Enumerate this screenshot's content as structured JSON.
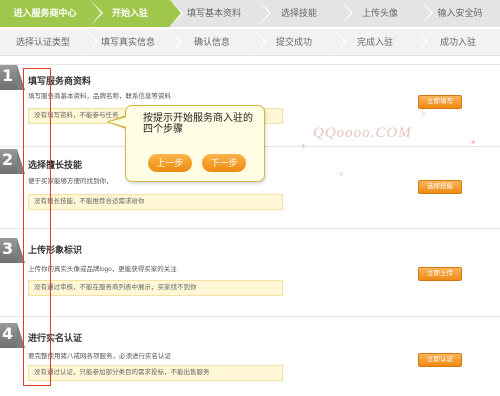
{
  "top_steps": [
    {
      "label": "进入服务商中心",
      "active": true
    },
    {
      "label": "开始入驻",
      "active": true
    },
    {
      "label": "填写基本资料",
      "active": false
    },
    {
      "label": "选择技能",
      "active": false
    },
    {
      "label": "上传头像",
      "active": false
    },
    {
      "label": "输入安全码",
      "active": false
    }
  ],
  "sub_steps": [
    {
      "label": "选择认证类型"
    },
    {
      "label": "填写真实信息"
    },
    {
      "label": "确认信息"
    },
    {
      "label": "提交成功"
    },
    {
      "label": "完成入驻"
    },
    {
      "label": "成功入驻"
    }
  ],
  "sections": [
    {
      "number": "1",
      "title": "填写服务商资料",
      "desc": "填写服务商基本资料，品牌名称，联系信息等资料",
      "note": "没有填写资料，不能参与任务",
      "button": "立即填写"
    },
    {
      "number": "2",
      "title": "选择擅长技能",
      "desc": "便于买家能够方便的找到你，",
      "note": "没有擅长技能，不能推荐合适需求给你",
      "button": "选择技能"
    },
    {
      "number": "3",
      "title": "上传形象标识",
      "desc": "上传你的真实头像或品牌logo，更能获得买家的关注",
      "note": "没有通过审核，不能在服务商列表中展示，买家找不到你",
      "button": "立即上传"
    },
    {
      "number": "4",
      "title": "进行实名认证",
      "desc": "要完整使用猪八戒网各项服务，必须进行实名认证",
      "note": "没有通过认证，只能参加部分类目的需求投标，不能出售服务",
      "button": "立即认证"
    }
  ],
  "tooltip": {
    "text": "按提示开始服务商入驻的四个步骤",
    "prev": "上一步",
    "next": "下一步"
  },
  "watermark": "QQoooo.COM",
  "colors": {
    "step_active": "#9ec74b",
    "button_orange": "#ef8a13",
    "note_bg": "#fff7d6",
    "highlight_red": "#e33b2a"
  }
}
